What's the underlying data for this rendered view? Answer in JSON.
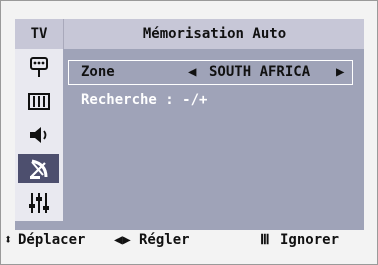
{
  "header": {
    "tv_label": "TV",
    "title": "Mémorisation Auto"
  },
  "sidebar": {
    "items": [
      {
        "icon": "input-plug-icon",
        "active": false
      },
      {
        "icon": "picture-film-icon",
        "active": false
      },
      {
        "icon": "speaker-icon",
        "active": false
      },
      {
        "icon": "satellite-dish-icon",
        "active": true
      },
      {
        "icon": "settings-sliders-icon",
        "active": false
      }
    ]
  },
  "content": {
    "zone_label": "Zone",
    "arrow_left": "◀",
    "zone_value": "SOUTH AFRICA",
    "arrow_right": "▶",
    "search_label": "Recherche : -/+"
  },
  "footer": {
    "move_icon": "⬍",
    "move_label": "Déplacer",
    "adjust_icon": "◀▶",
    "adjust_label": "Régler",
    "ignore_icon": "Ⅲ",
    "ignore_label": "Ignorer"
  },
  "colors": {
    "osd_bg": "#9fa3b8",
    "header_bg": "#c7c7d7",
    "active_icon_bg": "#4d4f6e",
    "highlight_text": "#ffffff"
  }
}
